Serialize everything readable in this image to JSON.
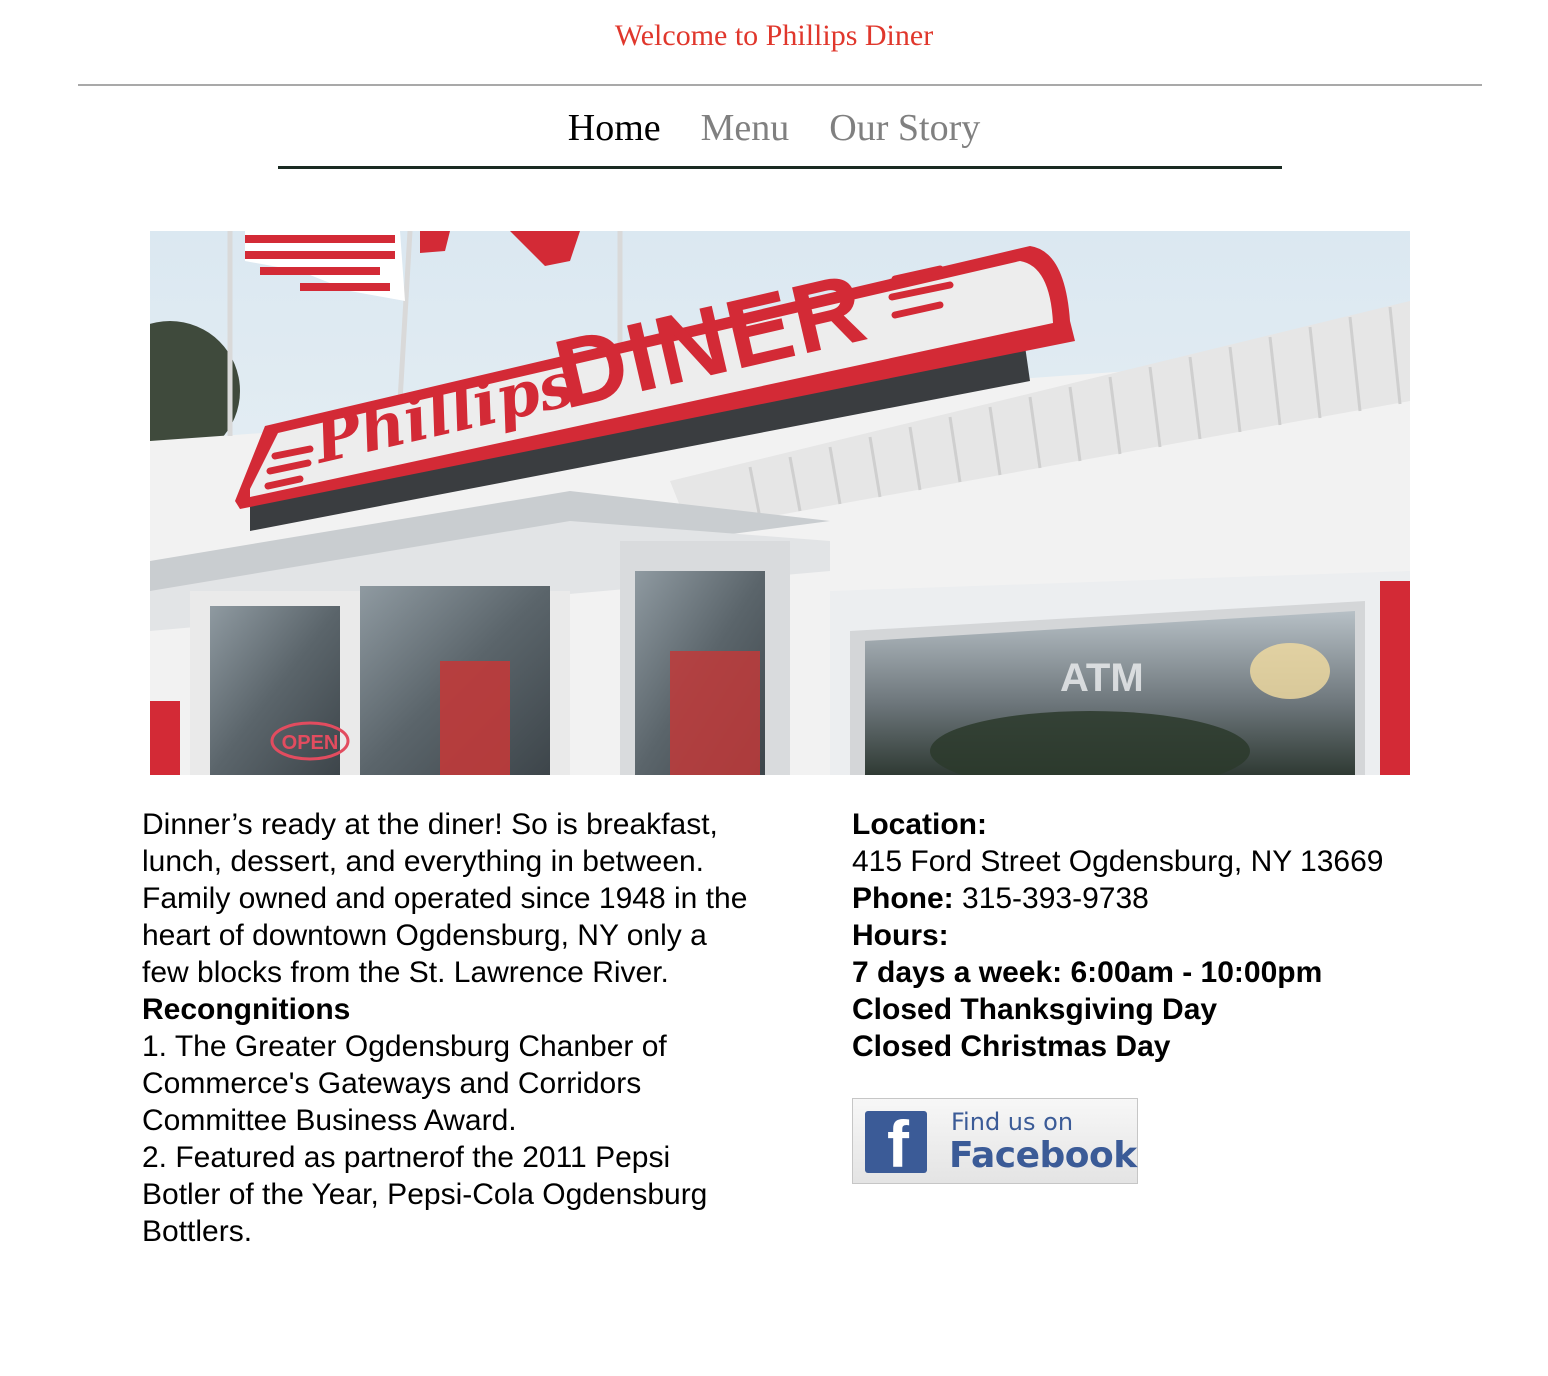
{
  "header": {
    "welcome": "Welcome to Phillips Diner"
  },
  "nav": {
    "items": [
      {
        "label": "Home",
        "active": true
      },
      {
        "label": "Menu",
        "active": false
      },
      {
        "label": "Our Story",
        "active": false
      }
    ]
  },
  "hero": {
    "sign_script": "Phillips",
    "sign_block": "DINER",
    "window_sign": "ATM",
    "neon_sign": "OPEN"
  },
  "about": {
    "paragraph_lines": [
      "Dinner’s ready at the diner! So is breakfast,",
      "lunch, dessert, and everything in between.",
      "Family owned and operated since 1948 in the",
      "heart of downtown Ogdensburg, NY only a",
      "few blocks from the St. Lawrence River."
    ],
    "recognitions_heading": "Recongnitions",
    "recognition_lines": [
      "1. The Greater Ogdensburg Chanber of",
      "Commerce's Gateways and Corridors",
      "Committee Business Award.",
      "2. Featured as partnerof the 2011 Pepsi",
      "Botler of the Year, Pepsi-Cola Ogdensburg",
      "Bottlers."
    ]
  },
  "info": {
    "location_label": "Location:",
    "address": "415 Ford Street Ogdensburg, NY 13669",
    "phone_label": "Phone:",
    "phone": " 315-393-9738",
    "hours_label": "Hours:",
    "hours_lines": [
      "7 days a week: 6:00am - 10:00pm",
      "Closed Thanksgiving Day",
      "Closed Christmas Day"
    ]
  },
  "facebook": {
    "icon_letter": "f",
    "find_text": "Find us on",
    "brand_text": "Facebook",
    "color": "#3b5b97"
  },
  "colors": {
    "welcome": "#e0372c",
    "nav_inactive": "#808080",
    "sign_red": "#d32a36"
  }
}
